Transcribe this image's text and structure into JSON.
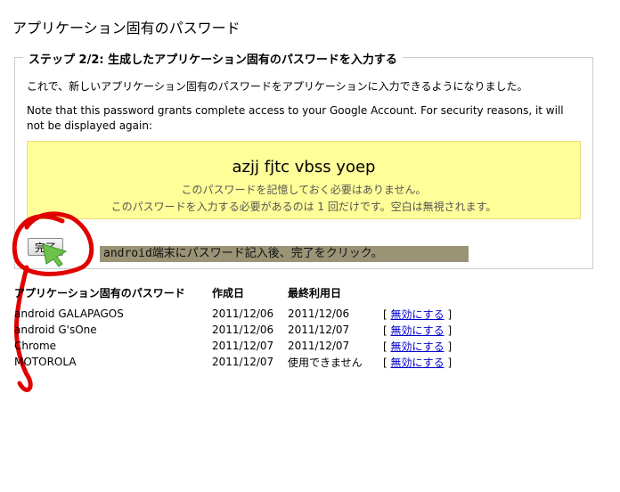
{
  "title": "アプリケーション固有のパスワード",
  "step": {
    "legend": "ステップ 2/2: 生成したアプリケーション固有のパスワードを入力する",
    "desc": "これで、新しいアプリケーション固有のパスワードをアプリケーションに入力できるようになりました。",
    "note": "Note that this password grants complete access to your Google Account. For security reasons, it will not be displayed again:",
    "password": "azjj fjtc vbss yoep",
    "pw_note1": "このパスワードを記憶しておく必要はありません。",
    "pw_note2": "このパスワードを入力する必要があるのは 1 回だけです。空白は無視されます。",
    "done_label": "完了"
  },
  "annotation_text": "android端末にパスワード記入後、完了をクリック。",
  "table": {
    "headers": [
      "アプリケーション固有のパスワード",
      "作成日",
      "最終利用日",
      ""
    ],
    "rows": [
      {
        "name": "android GALAPAGOS",
        "created": "2011/12/06",
        "last_used": "2011/12/06",
        "action": "無効にする"
      },
      {
        "name": "android G'sOne",
        "created": "2011/12/06",
        "last_used": "2011/12/07",
        "action": "無効にする"
      },
      {
        "name": "Chrome",
        "created": "2011/12/07",
        "last_used": "2011/12/07",
        "action": "無効にする"
      },
      {
        "name": "MOTOROLA",
        "created": "2011/12/07",
        "last_used": "使用できません",
        "action": "無効にする"
      }
    ]
  },
  "colors": {
    "highlight": "#ffff99",
    "link": "#0000cc",
    "annotation_circle": "#e00000",
    "arrow": "#6cc24a"
  }
}
